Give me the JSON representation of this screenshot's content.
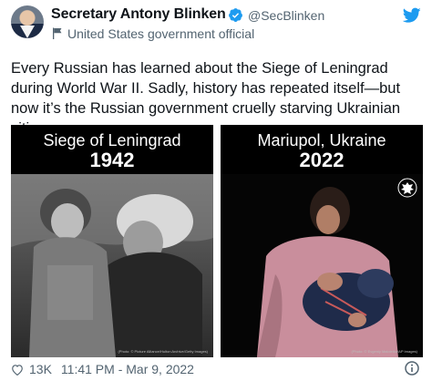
{
  "header": {
    "display_name": "Secretary Antony Blinken",
    "handle": "@SecBlinken",
    "affiliation": "United States government official"
  },
  "tweet": {
    "text": "Every Russian has learned about the Siege of Leningrad during World War II. Sadly, history has repeated itself—but now it’s the Russian government cruelly starving Ukrainian cities."
  },
  "panels": [
    {
      "title": "Siege of Leningrad",
      "year": "1942",
      "credit": "(Photo: © Picture Alliance/Hulton Archive/Getty Images)"
    },
    {
      "title": "Mariupol, Ukraine",
      "year": "2022",
      "credit": "(Photo: © Evgeniy Maloletka/AP Images)"
    }
  ],
  "footer": {
    "likes": "13K",
    "timestamp": "11:41 PM - Mar 9, 2022"
  },
  "colors": {
    "twitter_blue": "#1d9bf0",
    "text_primary": "#0f1419",
    "text_secondary": "#536471",
    "panel_bg": "#000000"
  },
  "icons": [
    "verified-badge-icon",
    "twitter-bird-icon",
    "government-flag-icon",
    "heart-icon",
    "info-icon",
    "us-seal-icon"
  ]
}
